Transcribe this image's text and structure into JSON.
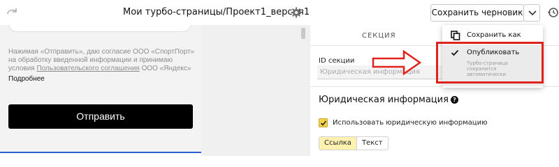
{
  "header": {
    "doc_title": "Мои турбо-страницы/Проект1_версия1",
    "save_draft_label": "Сохранить черновик"
  },
  "preview": {
    "consent_before": "Нажимая «Отправить», даю согласие ООО «СпортПорт» на обработку введенной информации и принимаю условия ",
    "consent_link": "Пользовательского соглашения",
    "consent_after": " ООО «Яндекс»",
    "more_label": "Подробнее",
    "submit_label": "Отправить"
  },
  "settings": {
    "section_header": "СЕКЦИЯ",
    "id_label": "ID секции",
    "id_value": "Юридическая информация",
    "legal_title": "Юридическая информация",
    "help_glyph": "?",
    "use_legal_label": "Использовать юридическую информацию",
    "use_legal_checked": true,
    "segments": [
      {
        "label": "Ссылка",
        "active": true
      },
      {
        "label": "Текст",
        "active": false
      }
    ]
  },
  "menu": {
    "save_as_label": "Сохранить как",
    "publish_label": "Опубликовать",
    "publish_note": "Турбо-страница сохранится автоматически"
  },
  "icons": {
    "redo": "redo-icon",
    "gear": "gear-icon",
    "chevron": "chevron-down-icon",
    "history": "history-icon",
    "copy": "copy-icon",
    "check": "check-icon",
    "help": "help-icon",
    "arrow": "red-arrow-annotation"
  },
  "colors": {
    "accent_yellow": "#f6d34a",
    "annotation_red": "#e0221c",
    "submit_bg": "#000000"
  }
}
